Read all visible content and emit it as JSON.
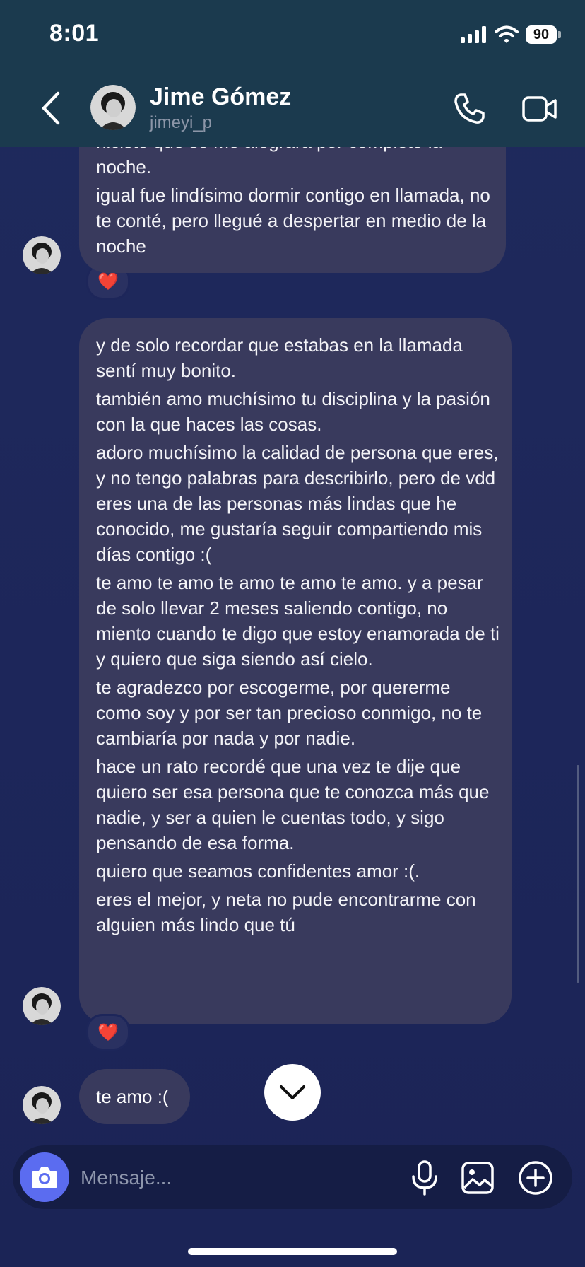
{
  "status_bar": {
    "time": "8:01",
    "battery": "90"
  },
  "header": {
    "contact_name": "Jime Gómez",
    "username": "jimeyi_p"
  },
  "messages": [
    {
      "lines": [
        "hiciste que se me alegrara por completo la",
        "noche.",
        "igual fue lindísimo dormir contigo en llamada, no te conté, pero llegué a despertar en medio de la noche"
      ],
      "reaction": "❤️"
    },
    {
      "lines": [
        "y de solo recordar que estabas en la llamada sentí muy bonito.",
        "también amo muchísimo tu disciplina y la pasión con la que haces las cosas.",
        "adoro muchísimo la calidad de persona que eres, y no tengo palabras para describirlo, pero de vdd eres una de las personas más lindas que he conocido, me gustaría seguir compartiendo mis días contigo :(",
        "te amo te amo te amo te amo te amo. y a pesar de solo llevar 2 meses saliendo contigo, no miento cuando te digo que estoy enamorada de ti y quiero que siga siendo así cielo.",
        "te agradezco por escogerme, por quererme como soy y por ser tan precioso conmigo, no te cambiaría por nada y por nadie.",
        "hace un rato recordé que una vez te dije que quiero ser esa persona que te conozca más que nadie, y ser a quien le cuentas todo, y sigo pensando de esa forma.",
        "quiero que seamos confidentes amor :(.",
        "eres el mejor, y neta no pude encontrarme con alguien más lindo que tú"
      ],
      "reaction": "❤️"
    },
    {
      "lines": [
        "te amo :("
      ]
    }
  ],
  "composer": {
    "placeholder": "Mensaje..."
  },
  "icons": {
    "back": "chevron-left-icon",
    "call": "phone-icon",
    "video": "video-camera-icon",
    "camera": "camera-icon",
    "mic": "microphone-icon",
    "gallery": "image-icon",
    "plus": "plus-circle-icon",
    "scroll": "chevron-down-icon",
    "reaction": "heart-icon"
  },
  "colors": {
    "background": "#1c2557",
    "header": "#1b3a4e",
    "bubble": "#393a5d",
    "camera_button": "#5b6cf0"
  }
}
